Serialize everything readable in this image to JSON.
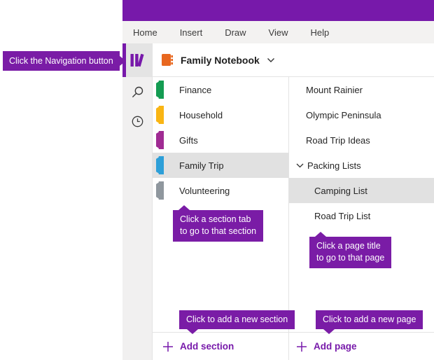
{
  "colors": {
    "titlebar": "#7719aa",
    "accent": "#7719aa",
    "callout": "#7a1ca6",
    "menubar_bg": "#f3f2f1",
    "rail_bg": "#f1f0f0",
    "nav_button_bg": "#e4e4e4",
    "selected_bg": "#e1e1e1",
    "divider": "#e3e3e3",
    "notebook_icon": "#e8671f"
  },
  "menu": {
    "items": [
      "Home",
      "Insert",
      "Draw",
      "View",
      "Help"
    ]
  },
  "rail": {
    "nav_icon": "books-icon",
    "search_icon": "search-icon",
    "recent_icon": "clock-icon"
  },
  "header": {
    "notebook_title": "Family Notebook",
    "notebook_icon": "notebook-icon",
    "chevron_icon": "chevron-down-icon"
  },
  "sections": {
    "items": [
      {
        "label": "Finance",
        "color": "#149c52",
        "selected": false
      },
      {
        "label": "Household",
        "color": "#f9b514",
        "selected": false
      },
      {
        "label": "Gifts",
        "color": "#a02b93",
        "selected": false
      },
      {
        "label": "Family Trip",
        "color": "#2d9fd8",
        "selected": true
      },
      {
        "label": "Volunteering",
        "color": "#8f979e",
        "selected": false
      }
    ],
    "add_label": "Add section"
  },
  "pages": {
    "items": [
      {
        "title": "Mount Rainier",
        "level": 1,
        "selected": false
      },
      {
        "title": "Olympic Peninsula",
        "level": 1,
        "selected": false
      },
      {
        "title": "Road Trip Ideas",
        "level": 1,
        "selected": false
      },
      {
        "title": "Packing Lists",
        "level": 1,
        "selected": false,
        "expanded": true
      },
      {
        "title": "Camping List",
        "level": 2,
        "selected": true
      },
      {
        "title": "Road Trip List",
        "level": 2,
        "selected": false
      }
    ],
    "add_label": "Add page"
  },
  "callouts": {
    "navigation": "Click the Navigation button",
    "section_line1": "Click a section tab",
    "section_line2": "to go to that section",
    "page_line1": "Click a page title",
    "page_line2": "to go to that page",
    "add_section": "Click to add a new section",
    "add_page": "Click to add a new page"
  }
}
